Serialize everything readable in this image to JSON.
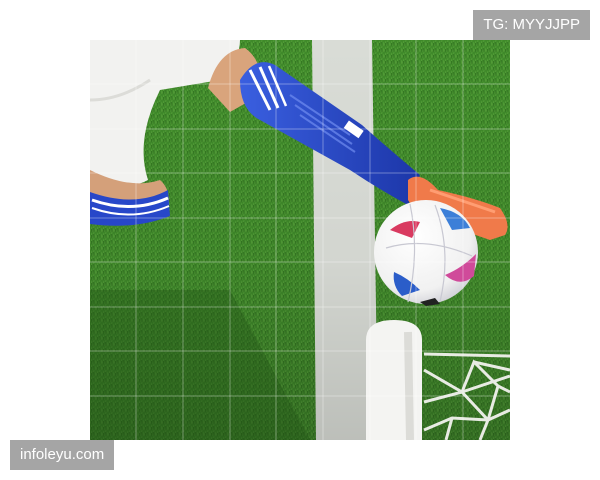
{
  "watermarks": {
    "top_right": "TG: MYYJJPP",
    "bottom_left": "infoleyu.com"
  },
  "scene": {
    "subject": "soccer ball on the goal line",
    "colors": {
      "grass": "#3f8a2a",
      "grass_dark": "#2e6e1e",
      "line": "#d9dcd6",
      "sock": "#2747c9",
      "boot": "#f07a4a",
      "post": "#f4f4f2"
    }
  }
}
